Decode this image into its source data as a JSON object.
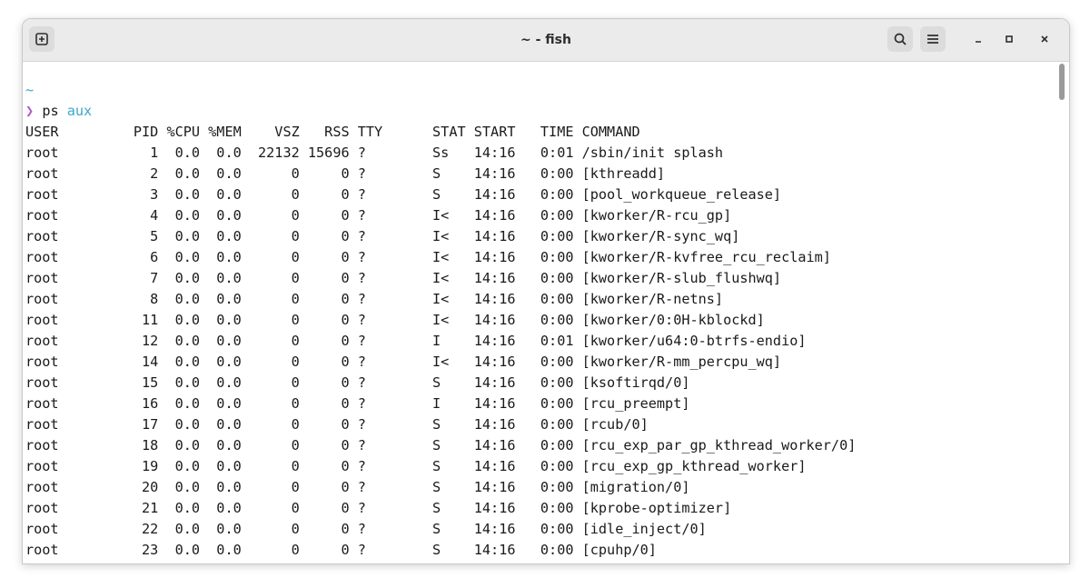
{
  "window": {
    "title": "~ - fish"
  },
  "icons": {
    "new_tab": "plus-square-icon",
    "search": "search-icon",
    "menu": "hamburger-menu-icon",
    "minimize": "minimize-icon",
    "maximize": "maximize-icon",
    "close": "close-icon"
  },
  "colors": {
    "cwd": "#3aa8c8",
    "prompt": "#b05cc8",
    "text": "#1a1a1a"
  },
  "terminal": {
    "cwd": "~",
    "prompt_symbol": "❯",
    "command": "ps",
    "command_args": "aux",
    "header": "USER         PID %CPU %MEM    VSZ   RSS TTY      STAT START   TIME COMMAND",
    "rows": [
      "root           1  0.0  0.0  22132 15696 ?        Ss   14:16   0:01 /sbin/init splash",
      "root           2  0.0  0.0      0     0 ?        S    14:16   0:00 [kthreadd]",
      "root           3  0.0  0.0      0     0 ?        S    14:16   0:00 [pool_workqueue_release]",
      "root           4  0.0  0.0      0     0 ?        I<   14:16   0:00 [kworker/R-rcu_gp]",
      "root           5  0.0  0.0      0     0 ?        I<   14:16   0:00 [kworker/R-sync_wq]",
      "root           6  0.0  0.0      0     0 ?        I<   14:16   0:00 [kworker/R-kvfree_rcu_reclaim]",
      "root           7  0.0  0.0      0     0 ?        I<   14:16   0:00 [kworker/R-slub_flushwq]",
      "root           8  0.0  0.0      0     0 ?        I<   14:16   0:00 [kworker/R-netns]",
      "root          11  0.0  0.0      0     0 ?        I<   14:16   0:00 [kworker/0:0H-kblockd]",
      "root          12  0.0  0.0      0     0 ?        I    14:16   0:01 [kworker/u64:0-btrfs-endio]",
      "root          14  0.0  0.0      0     0 ?        I<   14:16   0:00 [kworker/R-mm_percpu_wq]",
      "root          15  0.0  0.0      0     0 ?        S    14:16   0:00 [ksoftirqd/0]",
      "root          16  0.0  0.0      0     0 ?        I    14:16   0:00 [rcu_preempt]",
      "root          17  0.0  0.0      0     0 ?        S    14:16   0:00 [rcub/0]",
      "root          18  0.0  0.0      0     0 ?        S    14:16   0:00 [rcu_exp_par_gp_kthread_worker/0]",
      "root          19  0.0  0.0      0     0 ?        S    14:16   0:00 [rcu_exp_gp_kthread_worker]",
      "root          20  0.0  0.0      0     0 ?        S    14:16   0:00 [migration/0]",
      "root          21  0.0  0.0      0     0 ?        S    14:16   0:00 [kprobe-optimizer]",
      "root          22  0.0  0.0      0     0 ?        S    14:16   0:00 [idle_inject/0]",
      "root          23  0.0  0.0      0     0 ?        S    14:16   0:00 [cpuhp/0]"
    ]
  }
}
